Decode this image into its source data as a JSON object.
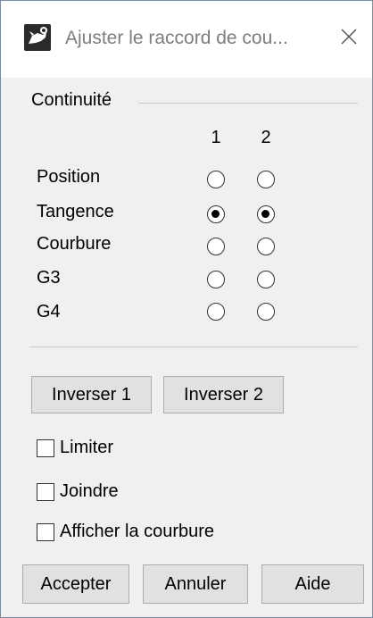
{
  "window": {
    "title": "Ajuster le raccord de cou...",
    "close_glyph": "✕"
  },
  "continuity": {
    "group_label": "Continuité",
    "columns": [
      "1",
      "2"
    ],
    "rows": [
      {
        "label": "Position",
        "selected": [
          false,
          false
        ]
      },
      {
        "label": "Tangence",
        "selected": [
          true,
          true
        ]
      },
      {
        "label": "Courbure",
        "selected": [
          false,
          false
        ]
      },
      {
        "label": "G3",
        "selected": [
          false,
          false
        ]
      },
      {
        "label": "G4",
        "selected": [
          false,
          false
        ]
      }
    ]
  },
  "actions": {
    "invert1": "Inverser 1",
    "invert2": "Inverser 2"
  },
  "options": {
    "limit": {
      "label": "Limiter",
      "checked": false
    },
    "join": {
      "label": "Joindre",
      "checked": false
    },
    "show_curvature": {
      "label": "Afficher la courbure",
      "checked": false
    }
  },
  "footer": {
    "accept": "Accepter",
    "cancel": "Annuler",
    "help": "Aide"
  },
  "icons": {
    "app": "rhino-app-icon",
    "close": "close-icon"
  }
}
